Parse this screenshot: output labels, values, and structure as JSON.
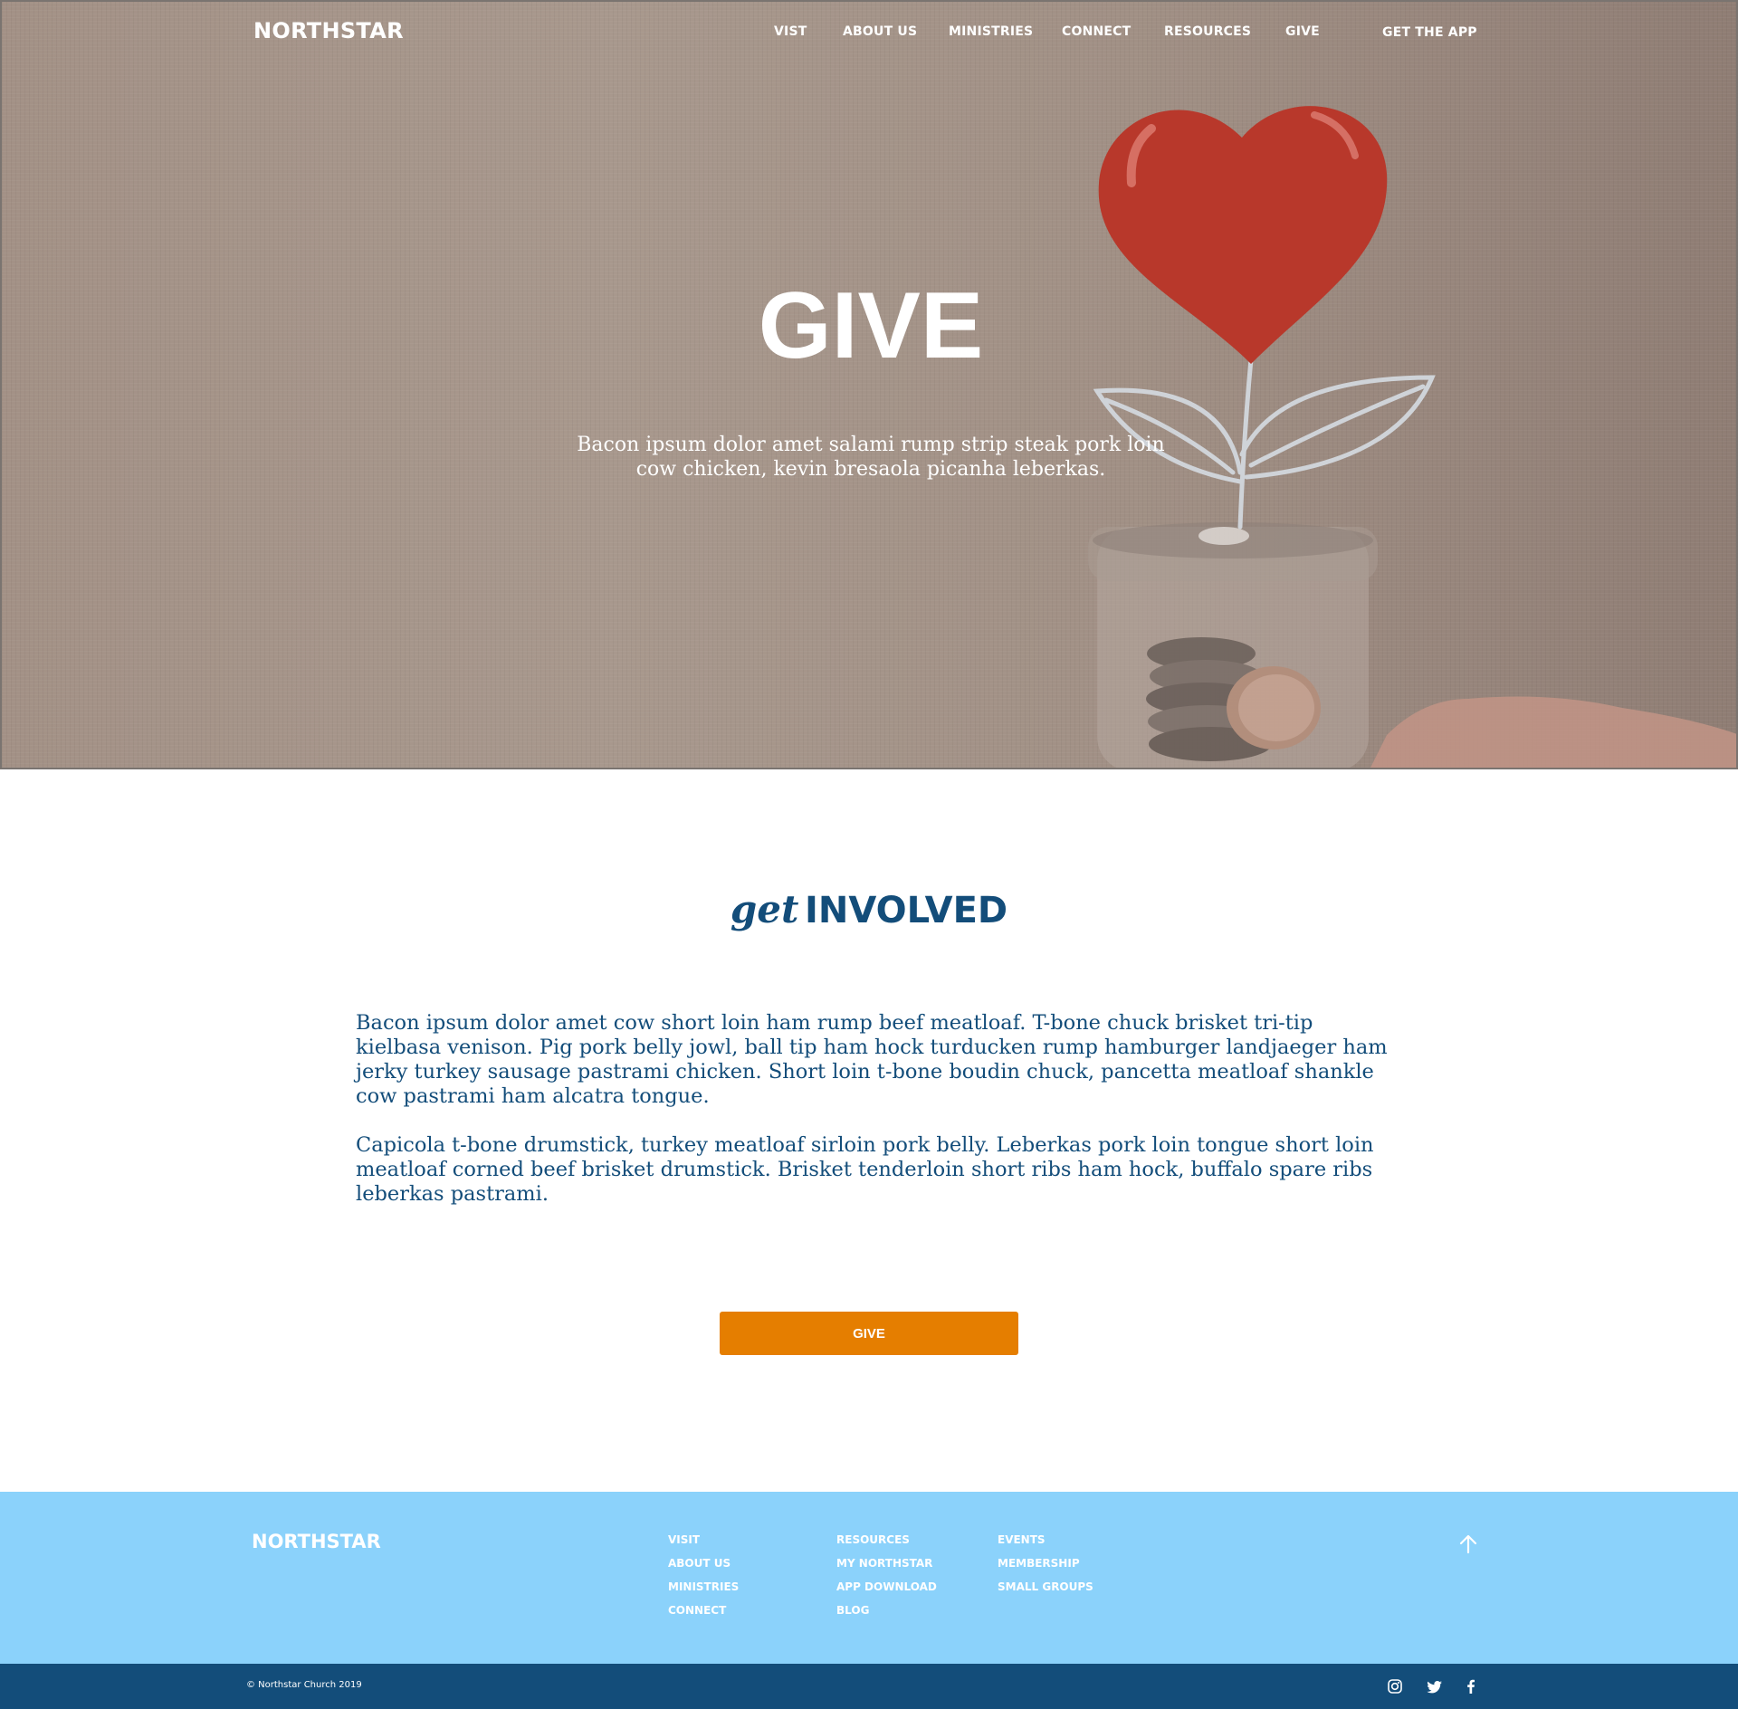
{
  "header": {
    "brand": "NORTHSTAR",
    "nav": [
      "VIST",
      "ABOUT US",
      "MINISTRIES",
      "CONNECT",
      "RESOURCES",
      "GIVE"
    ],
    "app_link": "GET THE APP"
  },
  "hero": {
    "title": "GIVE",
    "subtitle": "Bacon ipsum dolor amet salami rump strip steak pork loin cow chicken, kevin bresaola picanha leberkas.",
    "image": "heart-plant-coin-jar-photo"
  },
  "involved": {
    "heading_italic": "get",
    "heading_bold": "INVOLVED",
    "paragraphs": [
      "Bacon ipsum dolor amet cow short loin ham rump beef meatloaf. T-bone chuck brisket tri-tip kielbasa venison. Pig pork belly jowl, ball tip ham hock turducken rump hamburger landjaeger ham jerky turkey sausage pastrami chicken. Short loin t-bone boudin chuck, pancetta meatloaf shankle cow pastrami ham alcatra tongue.",
      "Capicola t-bone drumstick, turkey meatloaf sirloin pork belly. Leberkas pork loin tongue short loin meatloaf corned beef brisket drumstick. Brisket tenderloin short ribs ham hock, buffalo spare ribs leberkas pastrami."
    ],
    "button": "GIVE"
  },
  "footer": {
    "brand": "NORTHSTAR",
    "columns": [
      [
        "VISIT",
        "ABOUT US",
        "MINISTRIES",
        "CONNECT"
      ],
      [
        "RESOURCES",
        "MY NORTHSTAR",
        "APP DOWNLOAD",
        "BLOG"
      ],
      [
        "EVENTS",
        "MEMBERSHIP",
        "SMALL GROUPS"
      ]
    ],
    "to_top_icon": "arrow-up-icon",
    "copyright": "© Northstar Church 2019",
    "social": [
      "instagram-icon",
      "twitter-icon",
      "facebook-icon"
    ]
  },
  "colors": {
    "primary_blue": "#134d7a",
    "light_blue": "#8bd2fb",
    "accent_orange": "#e57e00",
    "heart_red": "#b8382b"
  }
}
